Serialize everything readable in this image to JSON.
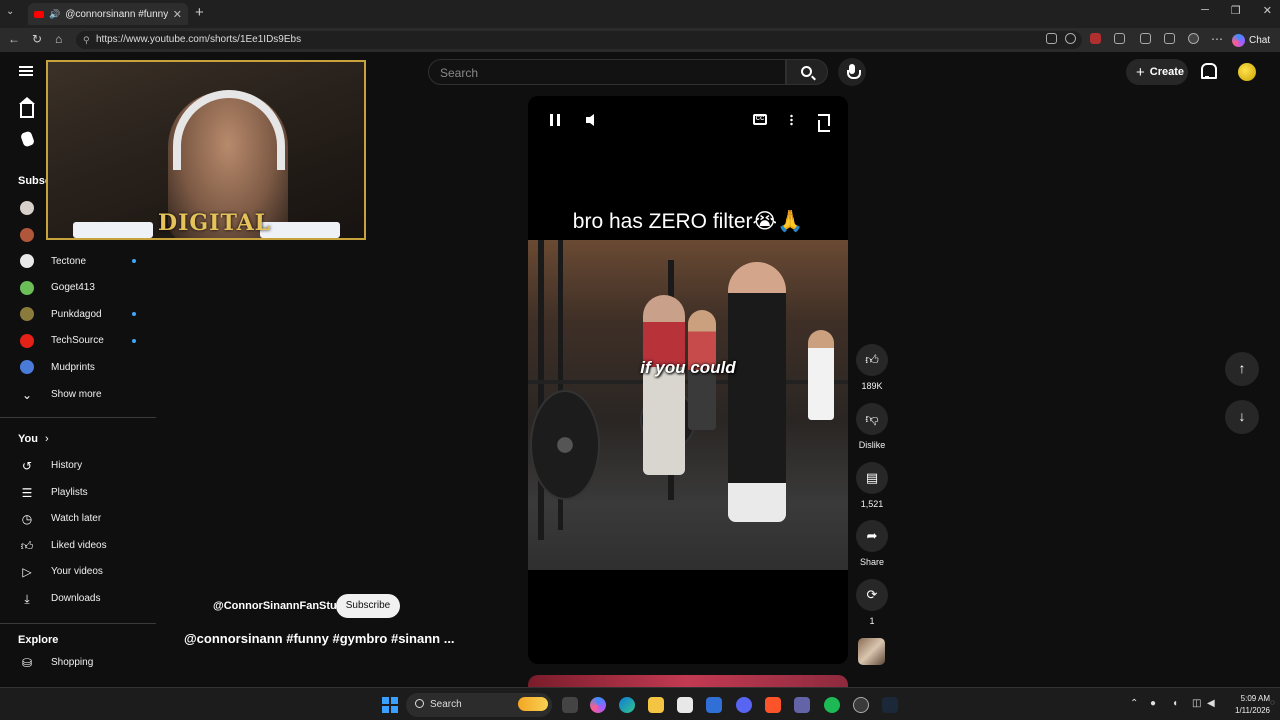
{
  "browser": {
    "tab_title": "@connorsinann #funny #gym",
    "url": "https://www.youtube.com/shorts/1Ee1IDs9Ebs",
    "chat_label": "Chat"
  },
  "header": {
    "search_placeholder": "Search",
    "create_label": "Create"
  },
  "sidebar": {
    "subscriptions_heading": "Subsc",
    "subscriptions": [
      {
        "name": "Tectone",
        "color": "#e9e9e9",
        "new": true
      },
      {
        "name": "Goget413",
        "color": "#6bbf59",
        "new": false
      },
      {
        "name": "Punkdagod",
        "color": "#8a7a3c",
        "new": true
      },
      {
        "name": "TechSource",
        "color": "#e62117",
        "new": true
      },
      {
        "name": "Mudprints",
        "color": "#4a7bd8",
        "new": false
      }
    ],
    "show_more": "Show more",
    "you_heading": "You",
    "you_items": [
      {
        "label": "History",
        "icon": "history-icon"
      },
      {
        "label": "Playlists",
        "icon": "playlists-icon"
      },
      {
        "label": "Watch later",
        "icon": "watch-later-icon"
      },
      {
        "label": "Liked videos",
        "icon": "liked-icon"
      },
      {
        "label": "Your videos",
        "icon": "your-videos-icon"
      },
      {
        "label": "Downloads",
        "icon": "download-icon"
      }
    ],
    "explore_heading": "Explore",
    "explore_items": [
      {
        "label": "Shopping",
        "icon": "shopping-icon"
      }
    ]
  },
  "webcam": {
    "logo_text": "DIGITAL"
  },
  "short": {
    "caption": "bro has ZERO filter😭🙏",
    "subtitle": "if you could",
    "channel": "@ConnorSinannFanStuff",
    "subscribe_label": "Subscribe",
    "title": "@connorsinann #funny #gymbro #sinann ..."
  },
  "actions": {
    "likes": "189K",
    "dislike_label": "Dislike",
    "comments": "1,521",
    "share_label": "Share",
    "remix_count": "1"
  },
  "taskbar": {
    "search_label": "Search",
    "time": "5:09 AM",
    "date": "1/11/2026"
  }
}
